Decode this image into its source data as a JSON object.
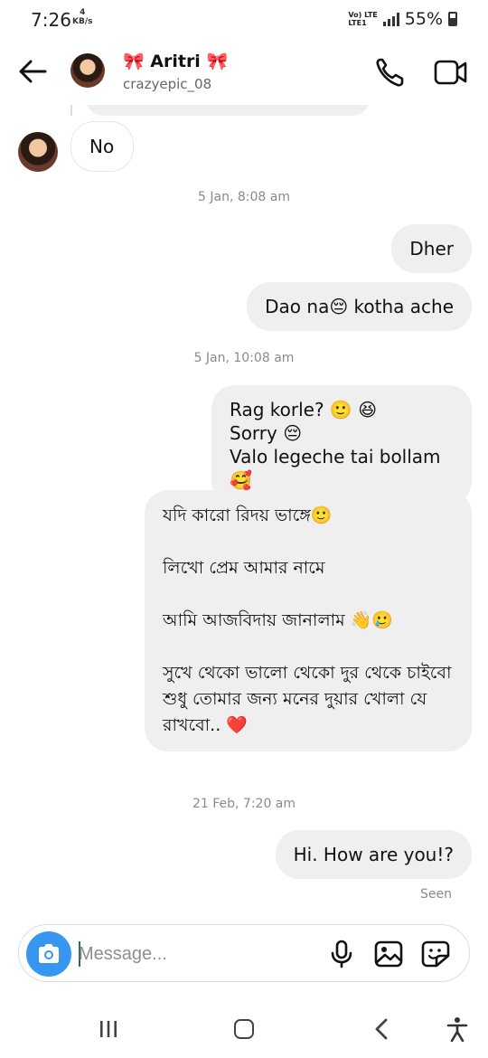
{
  "status_bar": {
    "time": "7:26",
    "speed_value": "4",
    "speed_unit": "KB/s",
    "network": "Vo) LTE",
    "network_sub": "LTE1",
    "battery": "55%"
  },
  "header": {
    "name": "🎀 Aritri 🎀",
    "username": "crazyepic_08"
  },
  "messages": {
    "incoming_1": "No",
    "ts_1": "5 Jan, 8:08 am",
    "out_1": "Dher",
    "out_2": "Dao na😔 kotha ache",
    "ts_2": "5 Jan, 10:08 am",
    "out_3": "Rag korle? 🙂 😆\nSorry 😔\nValo legeche tai bollam 🥰",
    "out_4": "যদি কারো রিদয় ভাঙ্গে🙂\n\nলিখো প্রেম আমার নামে\n\nআমি আজবিদায় জানালাম 👋🥲\n\nসুখে থেকো ভালো থেকো দুর থেকে চাইবো\nশুধু তোমার জন্য মনের দুয়ার খোলা যে রাখবো.. ❤️",
    "ts_3": "21 Feb, 7:20 am",
    "out_5": "Hi. How are you!?",
    "seen": "Seen"
  },
  "composer": {
    "placeholder": "Message..."
  },
  "icons": {
    "back": "arrow-left-icon",
    "call": "phone-icon",
    "video": "video-camera-icon",
    "camera": "camera-icon",
    "mic": "microphone-icon",
    "gallery": "image-icon",
    "sticker": "sticker-icon"
  },
  "colors": {
    "accent": "#3797f0",
    "bubble_out": "#efefef",
    "meta_text": "#8a8a8a"
  }
}
